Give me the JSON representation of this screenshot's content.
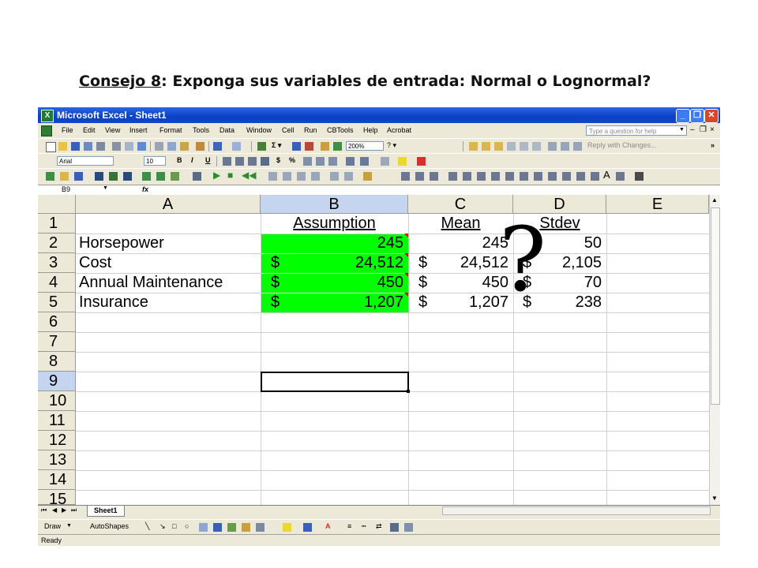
{
  "slide": {
    "title_prefix": "Consejo 8",
    "title_rest": ": Exponga sus variables de entrada: Normal o Lognormal?",
    "overlay": "?"
  },
  "window": {
    "title": "Microsoft Excel - Sheet1",
    "buttons": [
      "minimize",
      "restore",
      "close"
    ]
  },
  "menu": {
    "items": [
      "File",
      "Edit",
      "View",
      "Insert",
      "Format",
      "Tools",
      "Data",
      "Window",
      "Cell",
      "Run",
      "CBTools",
      "Help",
      "Acrobat"
    ],
    "help_placeholder": "Type a question for help"
  },
  "toolbar": {
    "zoom": "200%",
    "font": "Arial",
    "size": "10",
    "reply_text": "Reply with Changes...",
    "bold": "B",
    "italic": "I",
    "underline": "U",
    "currency": "$",
    "percent": "%"
  },
  "formula_bar": {
    "name_box": "B9",
    "fx": "fx"
  },
  "sheet": {
    "columns": [
      "A",
      "B",
      "C",
      "D",
      "E"
    ],
    "rows": [
      "1",
      "2",
      "3",
      "4",
      "5",
      "6",
      "7",
      "8",
      "9",
      "10",
      "11",
      "12",
      "13",
      "14",
      "15"
    ],
    "headers": {
      "assumption": "Assumption",
      "mean": "Mean",
      "stdev": "Stdev"
    },
    "data": [
      {
        "label": "Horsepower",
        "assumption": "245",
        "mean": "245",
        "stdev": "50",
        "dollar": ""
      },
      {
        "label": "Cost",
        "assumption": "24,512",
        "mean": "24,512",
        "stdev": "2,105",
        "dollar": "$"
      },
      {
        "label": "Annual Maintenance",
        "assumption": "450",
        "mean": "450",
        "stdev": "70",
        "dollar": "$"
      },
      {
        "label": "Insurance",
        "assumption": "1,207",
        "mean": "1,207",
        "stdev": "238",
        "dollar": "$"
      }
    ],
    "selected_cell": "B9",
    "highlight_color": "#00FF00"
  },
  "tabs": {
    "sheet": "Sheet1"
  },
  "draw": {
    "draw": "Draw",
    "autoshapes": "AutoShapes"
  },
  "status": {
    "text": "Ready"
  }
}
